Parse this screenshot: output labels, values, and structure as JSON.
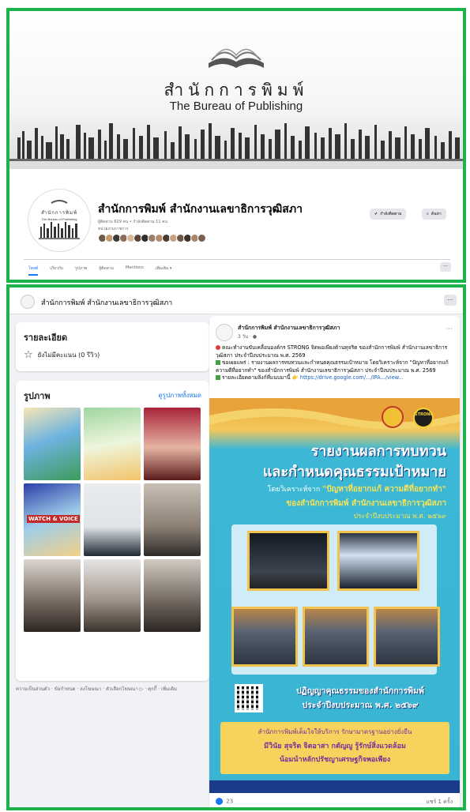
{
  "cover": {
    "title_th": "สำนักการพิมพ์",
    "title_en": "The Bureau of Publishing"
  },
  "profile": {
    "name": "สำนักการพิมพ์ สำนักงานเลขาธิการวุฒิสภา",
    "meta": "ผู้ติดตาม 629 คน • กำลังติดตาม 11 คน",
    "category": "หน่วยงานราชการ",
    "follow_button": "กำลังติดตาม",
    "search_button": "ค้นหา",
    "tabs": [
      "โพสต์",
      "เกี่ยวกับ",
      "รูปภาพ",
      "ผู้ติดตาม",
      "Mentions",
      "เพิ่มเติม ▾"
    ],
    "more_label": "···"
  },
  "feed_header": {
    "name": "สำนักการพิมพ์ สำนักงานเลขาธิการวุฒิสภา",
    "more_label": "···"
  },
  "details": {
    "title": "รายละเอียด",
    "rating": "ยังไม่มีคะแนน (0 รีวิว)"
  },
  "photos": {
    "title": "รูปภาพ",
    "see_all": "ดูรูปภาพทั้งหมด",
    "labels": [
      "WATCH & VOICE"
    ]
  },
  "footer_links": "ความเป็นส่วนตัว · ข้อกำหนด · ลงโฆษณา · ตัวเลือกโฆษณา ▷ · คุกกี้ · เพิ่มเติม",
  "post": {
    "author": "สำนักการพิมพ์ สำนักงานเลขาธิการวุฒิสภา",
    "time": "3 วัน · ●",
    "line1": "คณะทำงานขับเคลื่อนองค์กร STRONG จิตพอเพียงต้านทุจริต ของสำนักการพิมพ์ สำนักงานเลขาธิการวุฒิสภา ประจำปีงบประมาณ พ.ศ. 2569",
    "line2": "ขอเผยแพร่ : รายงานผลการทบทวนและกำหนดคุณธรรมเป้าหมาย โดยวิเคราะห์จาก \"ปัญหาที่อยากแก้ ความดีที่อยากทำ\" ของสำนักการพิมพ์ สำนักงานเลขาธิการวุฒิสภา ประจำปีงบประมาณ พ.ศ. 2569",
    "line3_prefix": "รายละเอียดตามลิงก์ที่แนบมานี้",
    "link": "https://drive.google.com/.../IPA.../view...",
    "likes": "23",
    "shares": "แชร์ 1 ครั้ง"
  },
  "poster": {
    "badge": "STRONG",
    "heading1": "รายงานผลการทบทวน",
    "heading2": "และกำหนดคุณธรรมเป้าหมาย",
    "line3_prefix": "โดยวิเคราะห์จาก",
    "line3_highlight": "\"ปัญหาที่อยากแก้ ความดีที่อยากทำ\"",
    "line4": "ของสำนักการพิมพ์ สำนักงานเลขาธิการวุฒิสภา",
    "line5": "ประจำปีงบประมาณ พ.ศ. ๒๕๖๙",
    "motto1": "ปฏิญญาคุณธรรมของสำนักการพิมพ์",
    "motto2": "ประจำปีงบประมาณ พ.ศ. ๒๕๖๙",
    "band1": "สำนักการพิมพ์เต็มใจให้บริการ รักษามาตรฐานอย่างยั่งยืน",
    "band2": "มีวินัย สุจริต จิตอาสา กตัญญู รู้รักษ์สิ่งแวดล้อม",
    "band3": "น้อมนำหลักปรัชญาเศรษฐกิจพอเพียง"
  },
  "colors": {
    "frame_green": "#1db24a",
    "facebook_blue": "#1877f2",
    "poster_blue": "#39b4d2",
    "poster_yellow": "#f6d35d"
  }
}
